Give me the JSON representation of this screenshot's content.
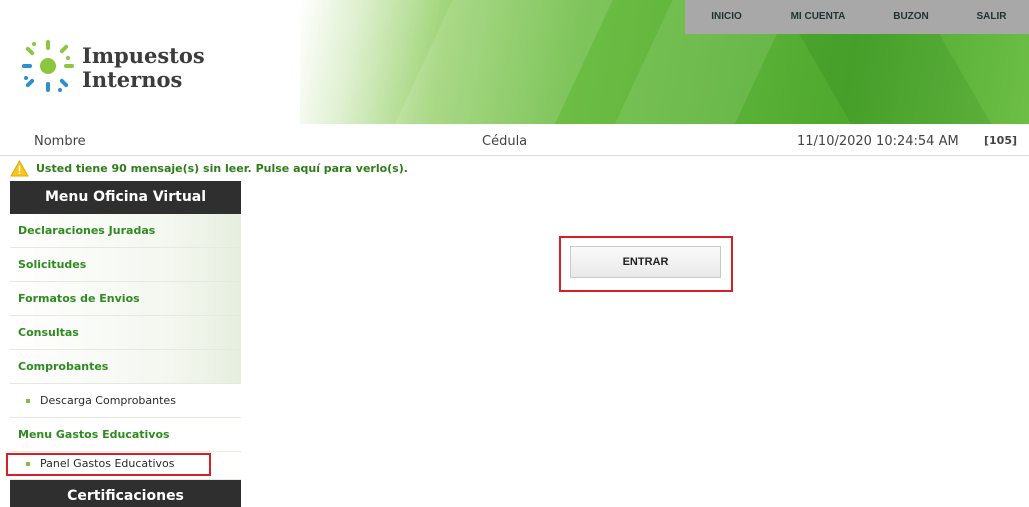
{
  "header": {
    "logo_line1": "Impuestos",
    "logo_line2": "Internos",
    "nav": [
      "INICIO",
      "MI CUENTA",
      "BUZON",
      "SALIR"
    ]
  },
  "infobar": {
    "nombre": "Nombre",
    "cedula": "Cédula",
    "datetime": "11/10/2020 10:24:54 AM",
    "code": "[105]"
  },
  "warning": {
    "text": "Usted tiene 90 mensaje(s) sin leer. Pulse aquí para verlo(s)."
  },
  "sidebar": {
    "title": "Menu Oficina Virtual",
    "items": [
      "Declaraciones Juradas",
      "Solicitudes",
      "Formatos de Envios",
      "Consultas",
      "Comprobantes"
    ],
    "sub_descarga": "Descarga Comprobantes",
    "gastos_title": "Menu Gastos Educativos",
    "sub_panel": "Panel Gastos Educativos",
    "cert_title": "Certificaciones"
  },
  "main": {
    "entrar_label": "ENTRAR"
  },
  "colors": {
    "brand_green": "#6dbd45",
    "link_green": "#2e8b1f",
    "highlight_red": "#d81f26",
    "menu_dark": "#2f2f2f"
  }
}
